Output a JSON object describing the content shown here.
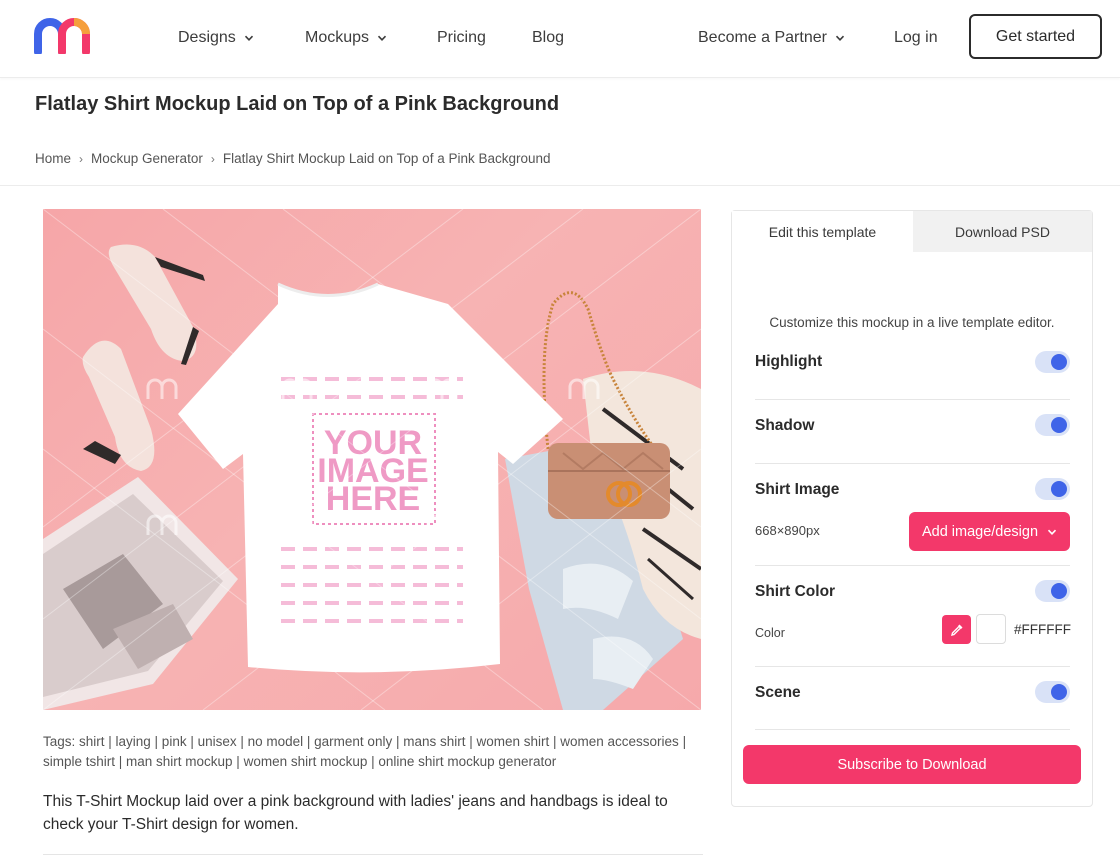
{
  "header": {
    "nav": {
      "designs": "Designs",
      "mockups": "Mockups",
      "pricing": "Pricing",
      "blog": "Blog",
      "partner": "Become a Partner",
      "login": "Log in"
    },
    "cta": "Get started"
  },
  "page": {
    "title": "Flatlay Shirt Mockup Laid on Top of a Pink Background",
    "breadcrumb": [
      "Home",
      "Mockup Generator",
      "Flatlay Shirt Mockup Laid on Top of a Pink Background"
    ]
  },
  "mockup": {
    "placeholder_lines": [
      "YOUR",
      "IMAGE",
      "HERE"
    ]
  },
  "tags_text": "Tags: shirt | laying | pink | unisex | no model | garment only | mans shirt | women shirt | women accessories | simple tshirt | man shirt mockup | women shirt mockup | online shirt mockup generator",
  "description": "This T-Shirt Mockup laid over a pink background with ladies' jeans and handbags is ideal to check your T-Shirt design for women.",
  "panel": {
    "tabs": [
      "Edit this template",
      "Download PSD"
    ],
    "active_tab": "Edit this template",
    "intro": "Customize this mockup in a live template editor.",
    "options": [
      {
        "label": "Highlight",
        "enabled": true
      },
      {
        "label": "Shadow",
        "enabled": true
      },
      {
        "label": "Shirt Image",
        "enabled": true
      },
      {
        "label": "Shirt Color",
        "enabled": true
      },
      {
        "label": "Scene",
        "enabled": true
      }
    ],
    "image_size": "668×890px",
    "add_image_label": "Add image/design",
    "color_label": "Color",
    "color_value": "#FFFFFF",
    "subscribe_label": "Subscribe to Download"
  },
  "colors": {
    "accent": "#f3386a",
    "toggle_on": "#3f64e8",
    "logo_blue": "#3f64e8",
    "logo_pink": "#f3386a",
    "mockup_bg": "#f7b3b3"
  }
}
